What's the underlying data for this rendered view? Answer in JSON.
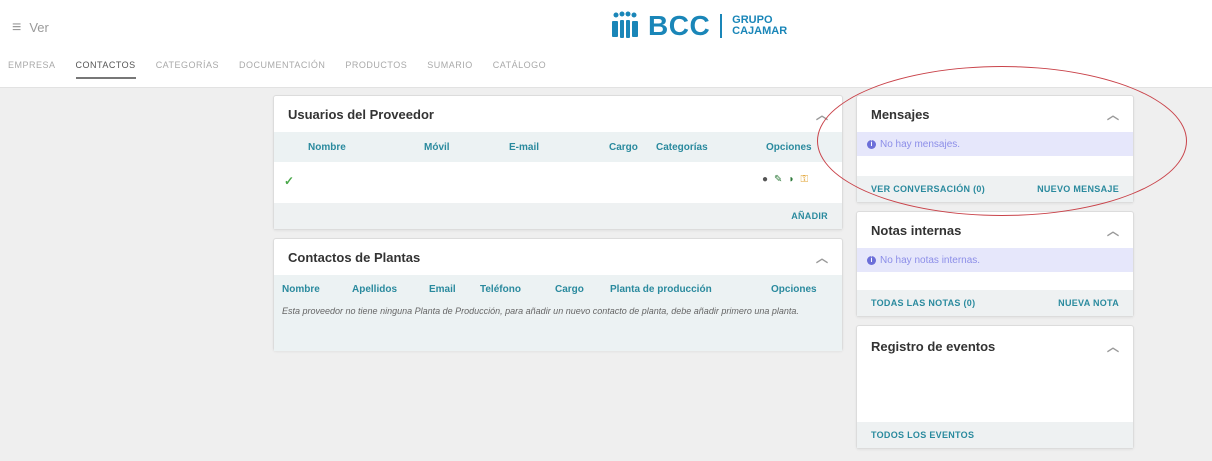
{
  "topbar": {
    "menu_label": "Ver",
    "brand": {
      "name": "BCC",
      "group_line1": "GRUPO",
      "group_line2": "CAJAMAR"
    },
    "tabs": [
      {
        "label": "EMPRESA",
        "active": false
      },
      {
        "label": "CONTACTOS",
        "active": true
      },
      {
        "label": "CATEGORÍAS",
        "active": false
      },
      {
        "label": "DOCUMENTACIÓN",
        "active": false
      },
      {
        "label": "PRODUCTOS",
        "active": false
      },
      {
        "label": "SUMARIO",
        "active": false
      },
      {
        "label": "CATÁLOGO",
        "active": false
      }
    ]
  },
  "usuarios": {
    "title": "Usuarios del Proveedor",
    "columns": [
      "Nombre",
      "Móvil",
      "E-mail",
      "Cargo",
      "Categorías",
      "Opciones"
    ],
    "row_status_icon": "check-icon",
    "row_actions": [
      "eye-icon",
      "pencil-icon",
      "rss-icon",
      "key-icon"
    ],
    "add_label": "AÑADIR"
  },
  "contactos": {
    "title": "Contactos de Plantas",
    "columns": [
      "Nombre",
      "Apellidos",
      "Email",
      "Teléfono",
      "Cargo",
      "Planta de producción",
      "Opciones"
    ],
    "empty_message": "Esta proveedor no tiene ninguna Planta de Producción, para añadir un nuevo contacto de planta, debe añadir primero una planta."
  },
  "mensajes": {
    "title": "Mensajes",
    "info": "No hay mensajes.",
    "left_action": "VER CONVERSACIÓN (0)",
    "right_action": "NUEVO MENSAJE"
  },
  "notas": {
    "title": "Notas internas",
    "info": "No hay notas internas.",
    "left_action": "TODAS LAS NOTAS (0)",
    "right_action": "NUEVA NOTA"
  },
  "registro": {
    "title": "Registro de eventos",
    "left_action": "TODOS LOS EVENTOS"
  },
  "colors": {
    "accent": "#2a8a9e",
    "brand": "#1a86b8",
    "info_bg": "#e6e7fb",
    "annotation": "#c9434a"
  }
}
